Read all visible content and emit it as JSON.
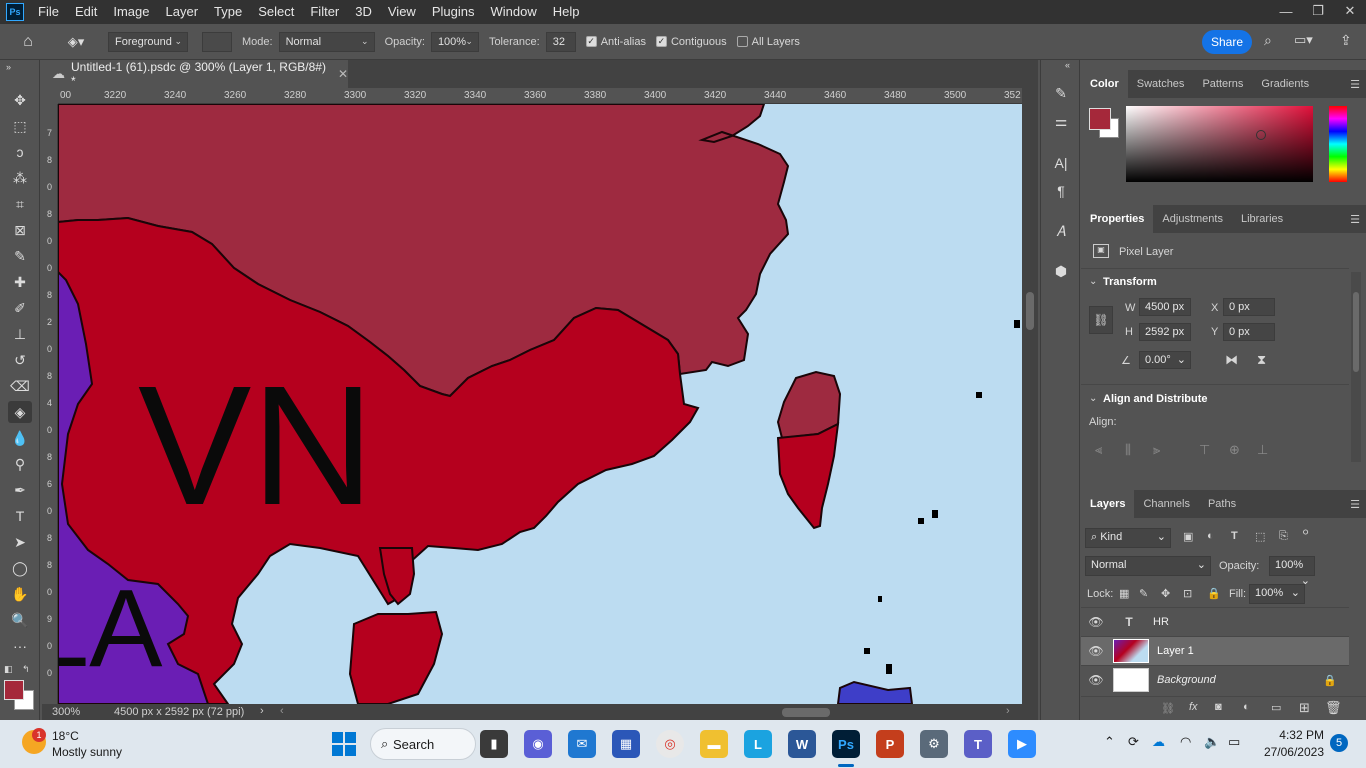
{
  "app": {
    "logo": "Ps",
    "menu": [
      "File",
      "Edit",
      "Image",
      "Layer",
      "Type",
      "Select",
      "Filter",
      "3D",
      "View",
      "Plugins",
      "Window",
      "Help"
    ],
    "window_controls": [
      "minimize-icon",
      "restore-icon",
      "close-icon"
    ]
  },
  "options_bar": {
    "fill_source": "Foreground",
    "mode_label": "Mode:",
    "mode_value": "Normal",
    "opacity_label": "Opacity:",
    "opacity_value": "100%",
    "tolerance_label": "Tolerance:",
    "tolerance_value": "32",
    "anti_alias_label": "Anti-alias",
    "anti_alias_checked": true,
    "contiguous_label": "Contiguous",
    "contiguous_checked": true,
    "all_layers_label": "All Layers",
    "all_layers_checked": false,
    "share_label": "Share"
  },
  "document": {
    "tab_title": "Untitled-1 (61).psdc @ 300% (Layer 1, RGB/8#) *",
    "ruler_h": [
      "00",
      "3220",
      "3240",
      "3260",
      "3280",
      "3300",
      "3320",
      "3340",
      "3360",
      "3380",
      "3400",
      "3420",
      "3440",
      "3460",
      "3480",
      "3500",
      "352"
    ],
    "ruler_v": [
      "7",
      "8",
      "0",
      "8",
      "0",
      "0",
      "8",
      "2",
      "0",
      "8",
      "4",
      "0",
      "8",
      "6",
      "0",
      "8",
      "8",
      "0",
      "9",
      "0",
      "0"
    ],
    "map_labels": {
      "vn": "VN",
      "la": "LA"
    },
    "status_zoom": "300%",
    "status_info": "4500 px x 2592 px (72 ppi)"
  },
  "panels": {
    "color_tabs": [
      "Color",
      "Swatches",
      "Patterns",
      "Gradients"
    ],
    "foreground_color": "#a5283a",
    "background_color": "#ffffff",
    "properties_tabs": [
      "Properties",
      "Adjustments",
      "Libraries"
    ],
    "pixel_layer_label": "Pixel Layer",
    "transform_heading": "Transform",
    "w_label": "W",
    "w_value": "4500 px",
    "h_label": "H",
    "h_value": "2592 px",
    "x_label": "X",
    "x_value": "0 px",
    "y_label": "Y",
    "y_value": "0 px",
    "angle_value": "0.00°",
    "align_heading": "Align and Distribute",
    "align_label": "Align:",
    "layers_tabs": [
      "Layers",
      "Channels",
      "Paths"
    ],
    "kind_label": "Kind",
    "blend_mode": "Normal",
    "layer_opacity_label": "Opacity:",
    "layer_opacity_value": "100%",
    "lock_label": "Lock:",
    "fill_label": "Fill:",
    "fill_value": "100%",
    "layers": [
      {
        "name": "HR",
        "type": "text"
      },
      {
        "name": "Layer 1",
        "type": "pixel",
        "selected": true
      },
      {
        "name": "Background",
        "type": "background",
        "locked": true
      }
    ]
  },
  "taskbar": {
    "weather_temp": "18°C",
    "weather_desc": "Mostly sunny",
    "weather_badge": "1",
    "search_label": "Search",
    "time": "4:32 PM",
    "date": "27/06/2023",
    "notification_count": "5"
  }
}
